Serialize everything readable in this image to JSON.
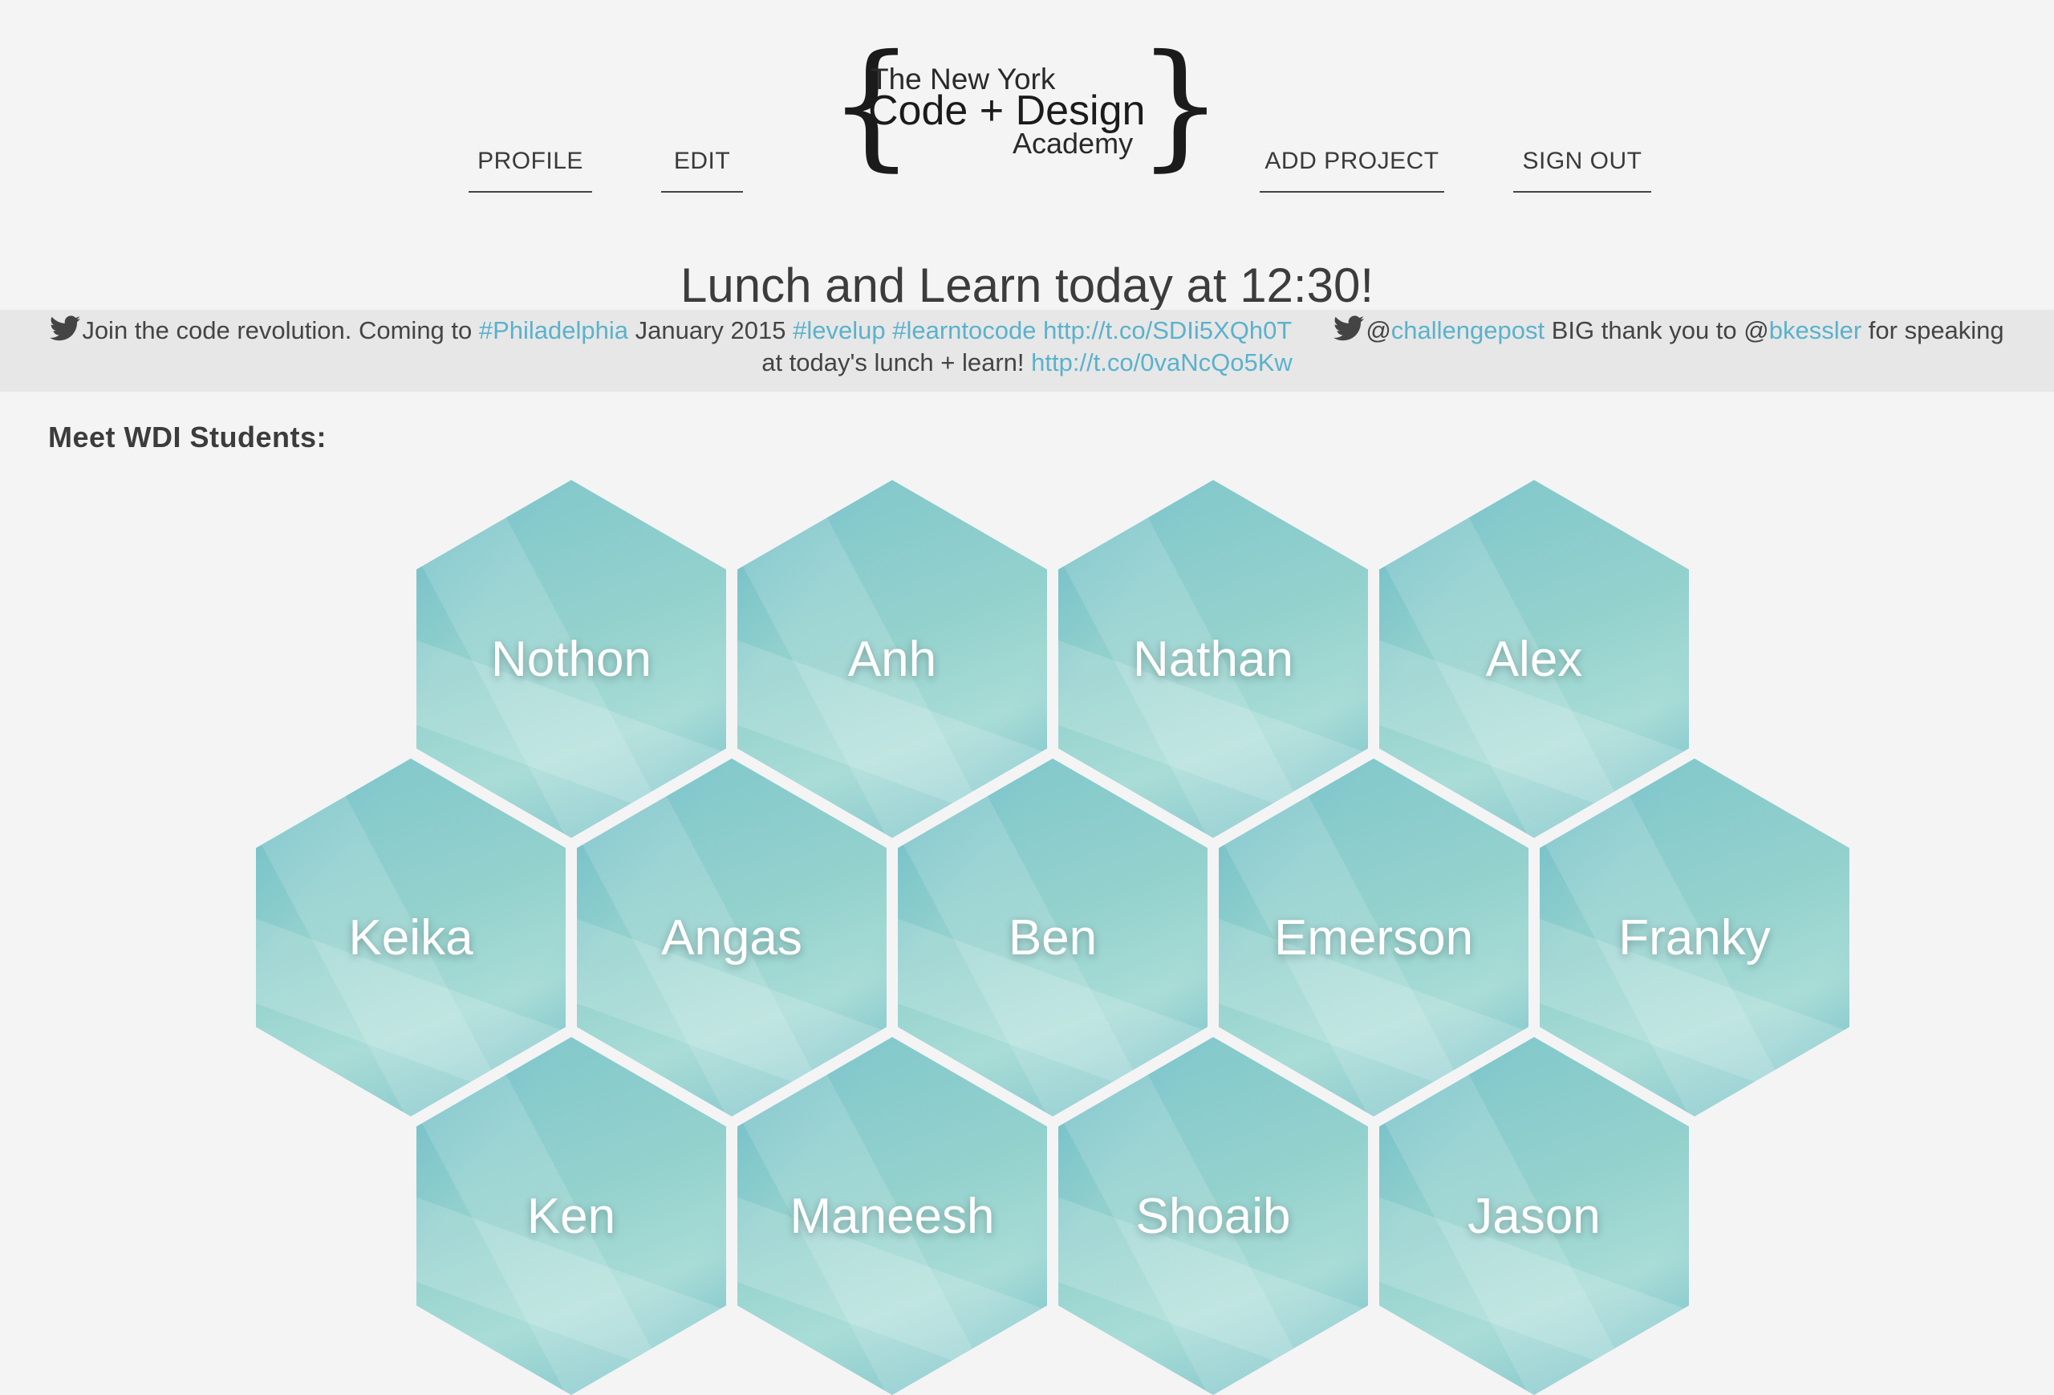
{
  "logo": {
    "line1": "The New York",
    "line2": "Code + Design",
    "line3": "Academy"
  },
  "nav": {
    "profile": "PROFILE",
    "edit": "EDIT",
    "add_project": "ADD PROJECT",
    "sign_out": "SIGN OUT"
  },
  "announcement": "Lunch and Learn today at 12:30!",
  "tweets": [
    {
      "icon": "twitter-bird-icon",
      "t1": "Join the code revolution. Coming to ",
      "l1": "#Philadelphia",
      "t2": " January 2015 ",
      "l2": "#levelup",
      "l3": "#learntocode",
      "l4": "http://t.co/SDIi5XQh0T"
    },
    {
      "icon": "twitter-bird-icon",
      "t1": "@",
      "l1": "challengepost",
      "t2": " BIG thank you to @",
      "l2": "bkessler",
      "t3": " for speaking at today's lunch + learn! ",
      "l3": "http://t.co/0vaNcQo5Kw"
    }
  ],
  "students_heading": "Meet WDI Students:",
  "students": [
    "Nothon",
    "Anh",
    "Nathan",
    "Alex",
    "Keika",
    "Angas",
    "Ben",
    "Emerson",
    "Franky",
    "Ken",
    "Maneesh",
    "Shoaib",
    "Jason"
  ],
  "colors": {
    "accent_link": "#5ab2cc",
    "hex_fill": "#93d1cd",
    "page_bg": "#f4f4f4",
    "tweet_bar_bg": "#e7e7e7"
  }
}
